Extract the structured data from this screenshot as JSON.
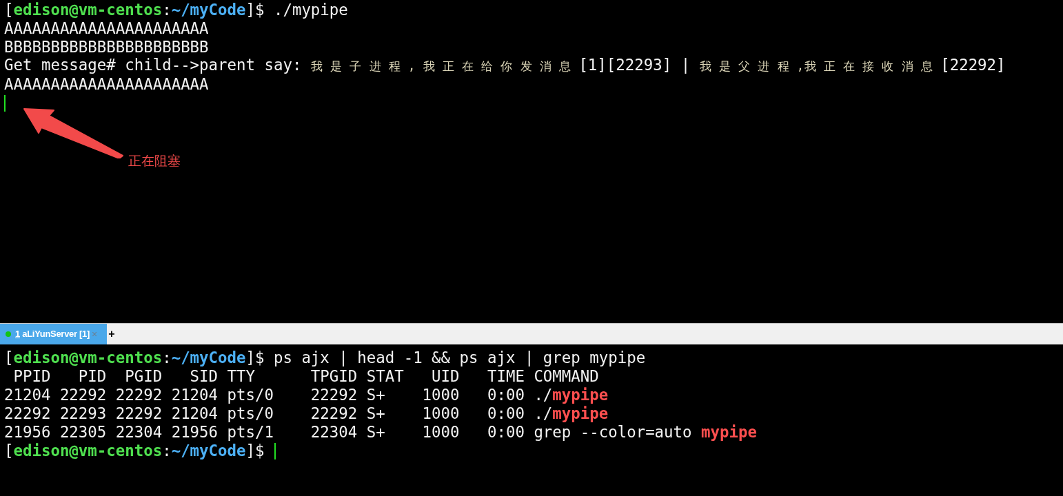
{
  "top_pane": {
    "lines": [
      [
        {
          "kind": "plain",
          "text": "["
        },
        {
          "kind": "user",
          "text": "edison@vm-centos"
        },
        {
          "kind": "plain",
          "text": ":"
        },
        {
          "kind": "path",
          "text": "~/myCode"
        },
        {
          "kind": "plain",
          "text": "]$ ./mypipe"
        }
      ],
      [
        {
          "kind": "plain",
          "text": "AAAAAAAAAAAAAAAAAAAAAA"
        }
      ],
      [
        {
          "kind": "plain",
          "text": "BBBBBBBBBBBBBBBBBBBBBB"
        }
      ],
      [
        {
          "kind": "plain",
          "text": "Get message# child-->parent say: "
        },
        {
          "kind": "cjk",
          "text": "我 是 子 进 程 , 我 正 在 给 你 发 消 息 "
        },
        {
          "kind": "plain",
          "text": "[1][22293] | "
        },
        {
          "kind": "cjk",
          "text": "我 是 父 进 程 ,我 正 在 接 收 消 息 "
        },
        {
          "kind": "plain",
          "text": "[22292]"
        }
      ],
      [
        {
          "kind": "plain",
          "text": "AAAAAAAAAAAAAAAAAAAAAA"
        }
      ]
    ],
    "cursor": true
  },
  "annotation": {
    "text": "正在阻塞"
  },
  "tabs": [
    {
      "accelerator": "1",
      "title": "aLiYunServer [1]",
      "selected": true,
      "color": "#13c413",
      "close": "×"
    }
  ],
  "new_tab": "+",
  "bottom_pane": {
    "lines": [
      [
        {
          "kind": "plain",
          "text": "["
        },
        {
          "kind": "user",
          "text": "edison@vm-centos"
        },
        {
          "kind": "plain",
          "text": ":"
        },
        {
          "kind": "path",
          "text": "~/myCode"
        },
        {
          "kind": "plain",
          "text": "]$ ps ajx | head -1 && ps ajx | grep mypipe"
        }
      ],
      [
        {
          "kind": "plain",
          "text": " PPID   PID  PGID   SID TTY      TPGID STAT   UID   TIME COMMAND"
        }
      ],
      [
        {
          "kind": "plain",
          "text": "21204 22292 22292 21204 pts/0    22292 S+    1000   0:00 ./"
        },
        {
          "kind": "match",
          "text": "mypipe"
        }
      ],
      [
        {
          "kind": "plain",
          "text": "22292 22293 22292 21204 pts/0    22292 S+    1000   0:00 ./"
        },
        {
          "kind": "match",
          "text": "mypipe"
        }
      ],
      [
        {
          "kind": "plain",
          "text": "21956 22305 22304 21956 pts/1    22304 S+    1000   0:00 grep --color=auto "
        },
        {
          "kind": "match",
          "text": "mypipe"
        }
      ],
      [
        {
          "kind": "plain",
          "text": "["
        },
        {
          "kind": "user",
          "text": "edison@vm-centos"
        },
        {
          "kind": "plain",
          "text": ":"
        },
        {
          "kind": "path",
          "text": "~/myCode"
        },
        {
          "kind": "plain",
          "text": "]$ "
        }
      ]
    ],
    "cursor": true
  }
}
